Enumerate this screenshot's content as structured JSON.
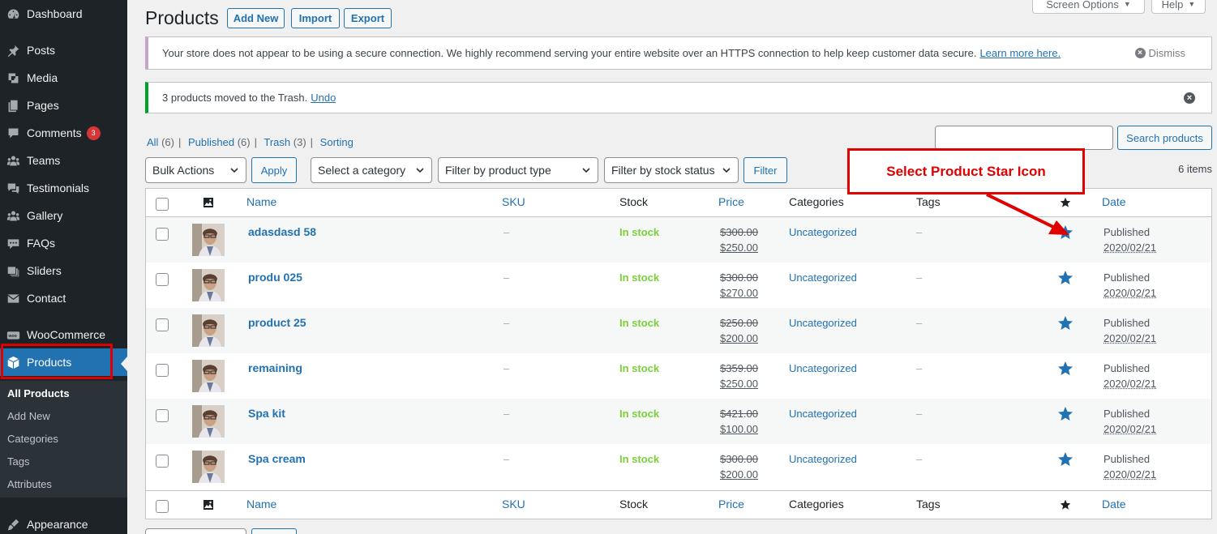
{
  "sidebar": {
    "items": [
      {
        "label": "Dashboard",
        "icon": "dashboard-icon"
      },
      {
        "label": "Posts",
        "icon": "pin-icon"
      },
      {
        "label": "Media",
        "icon": "media-icon"
      },
      {
        "label": "Pages",
        "icon": "pages-icon"
      },
      {
        "label": "Comments",
        "icon": "comment-icon",
        "badge": "3"
      },
      {
        "label": "Teams",
        "icon": "groups-icon"
      },
      {
        "label": "Testimonials",
        "icon": "testimonial-icon"
      },
      {
        "label": "Gallery",
        "icon": "groups-icon"
      },
      {
        "label": "FAQs",
        "icon": "faq-icon"
      },
      {
        "label": "Sliders",
        "icon": "slider-icon"
      },
      {
        "label": "Contact",
        "icon": "mail-icon"
      },
      {
        "label": "WooCommerce",
        "icon": "woo-icon"
      },
      {
        "label": "Products",
        "icon": "box-icon"
      },
      {
        "label": "Appearance",
        "icon": "brush-icon"
      }
    ],
    "submenu": [
      "All Products",
      "Add New",
      "Categories",
      "Tags",
      "Attributes"
    ]
  },
  "header": {
    "title": "Products",
    "add_new": "Add New",
    "import": "Import",
    "export": "Export",
    "screen_options": "Screen Options",
    "help": "Help"
  },
  "notices": {
    "https_text": "Your store does not appear to be using a secure connection. We highly recommend serving your entire website over an HTTPS connection to help keep customer data secure.",
    "https_link": "Learn more here.",
    "dismiss": "Dismiss",
    "trash_text": "3 products moved to the Trash.",
    "undo": "Undo"
  },
  "views": {
    "all": "All",
    "all_count": "(6)",
    "published": "Published",
    "published_count": "(6)",
    "trash": "Trash",
    "trash_count": "(3)",
    "sorting": "Sorting"
  },
  "search": {
    "value": "",
    "button": "Search products"
  },
  "filters": {
    "bulk_actions": "Bulk Actions",
    "apply": "Apply",
    "category": "Select a category",
    "product_type": "Filter by product type",
    "stock_status": "Filter by stock status",
    "filter": "Filter",
    "items_count": "6 items"
  },
  "columns": {
    "name": "Name",
    "sku": "SKU",
    "stock": "Stock",
    "price": "Price",
    "categories": "Categories",
    "tags": "Tags",
    "date": "Date"
  },
  "products": [
    {
      "name": "adasdasd 58",
      "sku": "–",
      "stock": "In stock",
      "old_price": "$300.00",
      "new_price": "$250.00",
      "category": "Uncategorized",
      "tags": "–",
      "status": "Published",
      "date": "2020/02/21"
    },
    {
      "name": "produ 025",
      "sku": "–",
      "stock": "In stock",
      "old_price": "$300.00",
      "new_price": "$270.00",
      "category": "Uncategorized",
      "tags": "–",
      "status": "Published",
      "date": "2020/02/21"
    },
    {
      "name": "product 25",
      "sku": "–",
      "stock": "In stock",
      "old_price": "$250.00",
      "new_price": "$200.00",
      "category": "Uncategorized",
      "tags": "–",
      "status": "Published",
      "date": "2020/02/21"
    },
    {
      "name": "remaining",
      "sku": "–",
      "stock": "In stock",
      "old_price": "$359.00",
      "new_price": "$250.00",
      "category": "Uncategorized",
      "tags": "–",
      "status": "Published",
      "date": "2020/02/21"
    },
    {
      "name": "Spa kit",
      "sku": "–",
      "stock": "In stock",
      "old_price": "$421.00",
      "new_price": "$100.00",
      "category": "Uncategorized",
      "tags": "–",
      "status": "Published",
      "date": "2020/02/21"
    },
    {
      "name": "Spa cream",
      "sku": "–",
      "stock": "In stock",
      "old_price": "$300.00",
      "new_price": "$200.00",
      "category": "Uncategorized",
      "tags": "–",
      "status": "Published",
      "date": "2020/02/21"
    }
  ],
  "annotation": {
    "callout": "Select Product Star Icon"
  },
  "colors": {
    "accent": "#2271b1",
    "in_stock": "#7ad03a",
    "annotation": "#e00000",
    "sidebar": "#1d2327"
  }
}
